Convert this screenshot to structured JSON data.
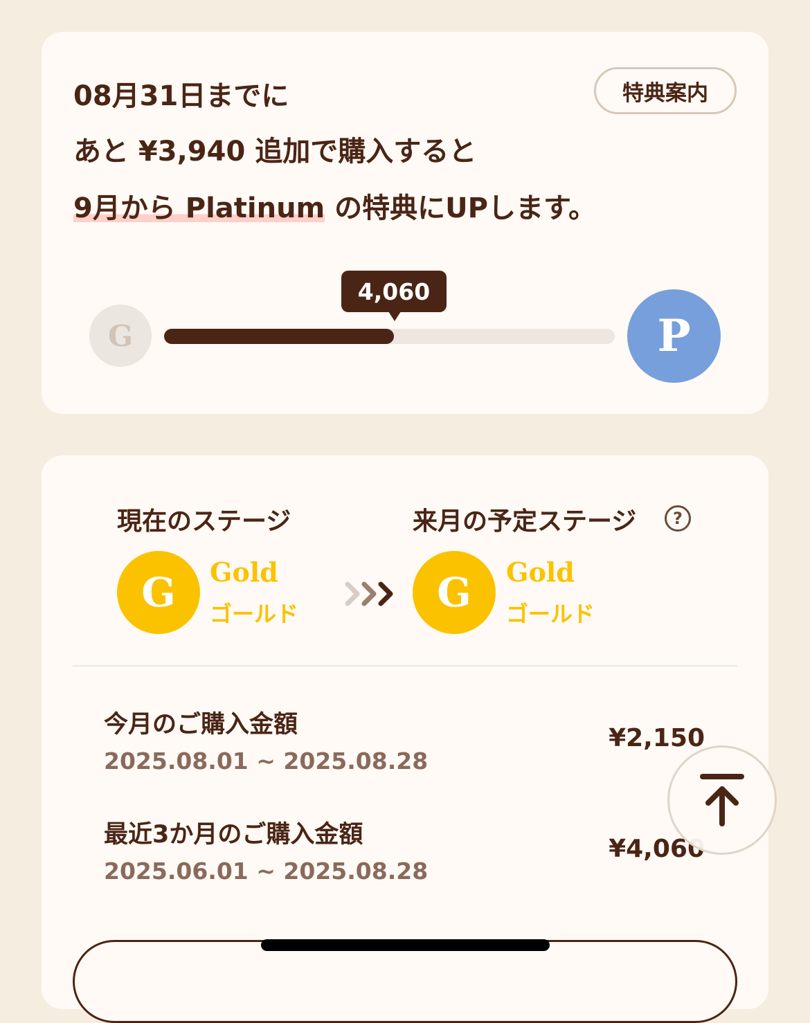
{
  "progress_card": {
    "line1": "08月31日までに",
    "line2": "あと ¥3,940 追加で購入すると",
    "line3_highlight": "9月から Platinum",
    "line3_rest": " の特典にUPします。",
    "guide_button": "特典案内",
    "current_badge": "G",
    "target_badge": "P",
    "current_value_label": "4,060",
    "progress_ratio": 0.51,
    "colors": {
      "progress_fill": "#4a2516",
      "platinum": "#779fdc",
      "highlight": "#ffcfc9"
    }
  },
  "stage_card": {
    "current_label": "現在のステージ",
    "next_label": "来月の予定ステージ",
    "help_icon": "?",
    "current_stage": {
      "badge": "G",
      "name_en": "Gold",
      "name_ja": "ゴールド"
    },
    "next_stage": {
      "badge": "G",
      "name_en": "Gold",
      "name_ja": "ゴールド"
    },
    "gold_color": "#fbc200",
    "rows": [
      {
        "title": "今月のご購入金額",
        "period": "2025.08.01 ~ 2025.08.28",
        "amount": "¥2,150"
      },
      {
        "title": "最近3か月のご購入金額",
        "period": "2025.06.01 ~ 2025.08.28",
        "amount": "¥4,060"
      }
    ],
    "bottom_button": ""
  },
  "icons": {
    "scroll_top": "arrow-up-to-top-icon",
    "stage_arrows": "triple-chevron-right-icon",
    "help": "question-circle-icon"
  }
}
